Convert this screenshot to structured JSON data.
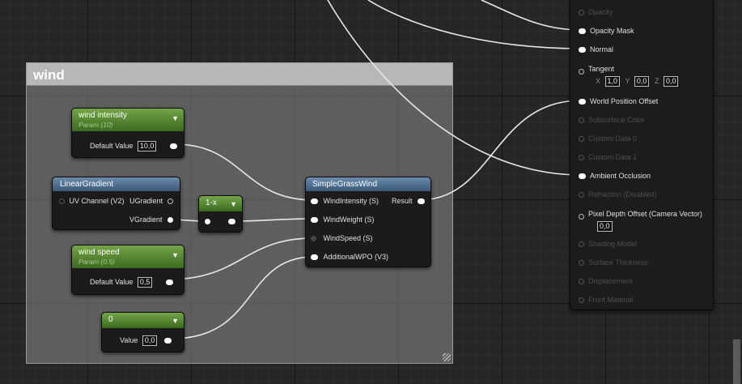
{
  "comment": {
    "title": "wind"
  },
  "wind_intensity": {
    "name": "wind intensity",
    "sub": "Param (10)",
    "label": "Default Value",
    "value": "10,0"
  },
  "linear_gradient": {
    "name": "LinearGradient",
    "uv": "UV Channel (V2)",
    "ugrad": "UGradient",
    "vgrad": "VGradient"
  },
  "one_minus": {
    "name": "1-x"
  },
  "wind_speed": {
    "name": "wind speed",
    "sub": "Param (0.5)",
    "label": "Default Value",
    "value": "0,5"
  },
  "zero": {
    "name": "0",
    "label": "Value",
    "value": "0,0"
  },
  "grass": {
    "name": "SimpleGrassWind",
    "inputs": [
      "WindIntensity (S)",
      "WindWeight (S)",
      "WindSpeed (S)",
      "AdditionalWPO (V3)"
    ],
    "output": "Result"
  },
  "material": {
    "opacity": "Opacity",
    "opacity_mask": "Opacity Mask",
    "normal": "Normal",
    "tangent": "Tangent",
    "tx_label": "X",
    "tx": "1,0",
    "ty_label": "Y",
    "ty": "0,0",
    "tz_label": "Z",
    "tz": "0,0",
    "wpo": "World Position Offset",
    "subsurface": "Subsurface Color",
    "custom0": "Custom Data 0",
    "custom1": "Custom Data 1",
    "ao": "Ambient Occlusion",
    "refraction": "Refraction (Disabled)",
    "pdo": "Pixel Depth Offset (Camera Vector)",
    "pdo_value": "0,0",
    "shading_model": "Shading Model",
    "surface_thickness": "Surface Thickness",
    "displacement": "Displacement",
    "front_material": "Front Material"
  }
}
